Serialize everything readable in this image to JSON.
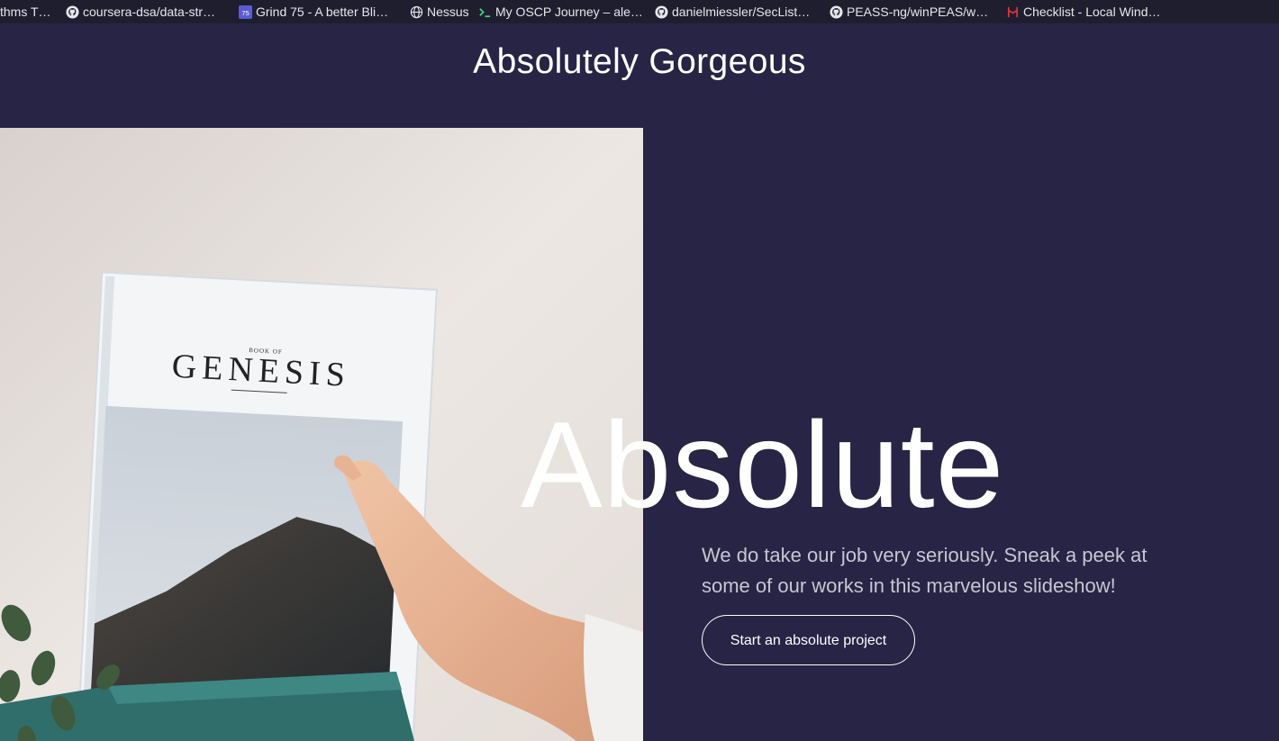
{
  "bookmarks": [
    {
      "label": "thms T…",
      "icon": "none"
    },
    {
      "label": "coursera-dsa/data-str…",
      "icon": "github-icon"
    },
    {
      "label": "Grind 75 - A better Bli…",
      "icon": "grind75-icon",
      "icon_text": "75"
    },
    {
      "label": "Nessus",
      "icon": "globe-icon"
    },
    {
      "label": "My OSCP Journey – ale…",
      "icon": "terminal-icon"
    },
    {
      "label": "danielmiessler/SecList…",
      "icon": "github-icon"
    },
    {
      "label": "PEASS-ng/winPEAS/w…",
      "icon": "github-icon"
    },
    {
      "label": "Checklist - Local Wind…",
      "icon": "hacktricks-icon"
    }
  ],
  "header": {
    "title": "Absolutely Gorgeous"
  },
  "hero": {
    "heading": "Absolute",
    "text": "We do take our job very seriously. Sneak a peek at some of our works in this marvelous slideshow!",
    "cta_label": "Start an absolute project",
    "image": {
      "book_small_text": "BOOK OF",
      "book_title": "GENESIS"
    }
  },
  "colors": {
    "background": "#272445",
    "bookmark_bar": "#1f1e2e",
    "text_primary": "#ffffff",
    "text_muted": "#c7c6d3"
  }
}
